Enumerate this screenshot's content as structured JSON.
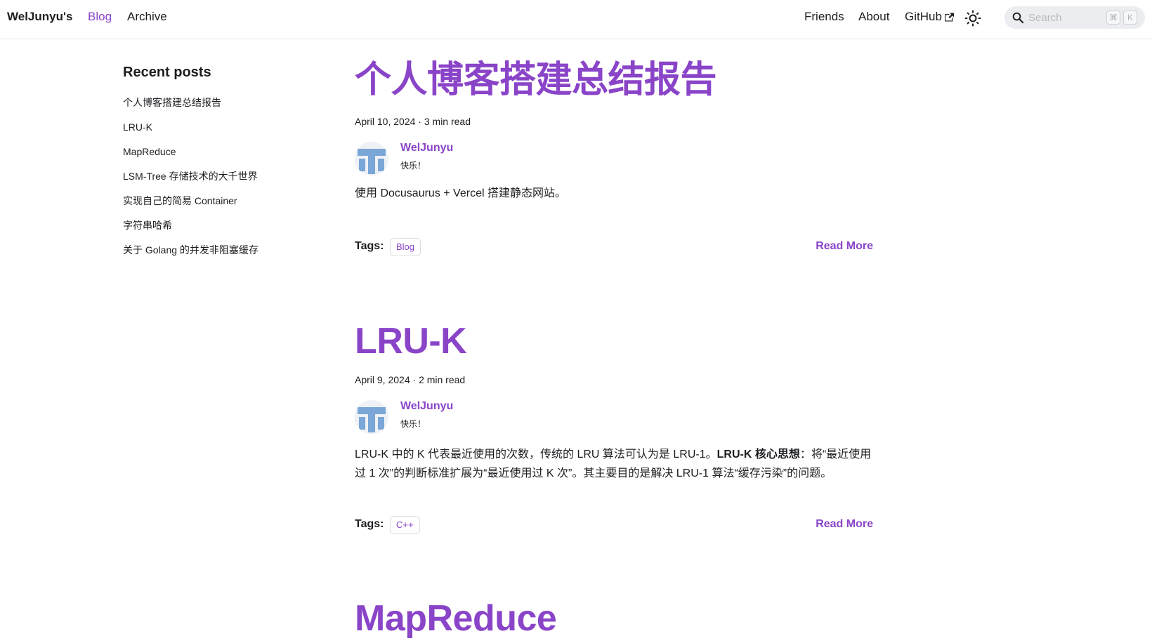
{
  "navbar": {
    "brand": "WelJunyu's",
    "left_items": [
      "Blog",
      "Archive"
    ],
    "right_items": {
      "friends": "Friends",
      "about": "About",
      "github": "GitHub"
    },
    "theme_icon": "sun-icon",
    "search": {
      "placeholder": "Search",
      "kbd_cmd": "⌘",
      "kbd_k": "K"
    }
  },
  "sidebar": {
    "title": "Recent posts",
    "items": [
      "个人博客搭建总结报告",
      "LRU-K",
      "MapReduce",
      "LSM-Tree 存储技术的大千世界",
      "实现自己的简易 Container",
      "字符串哈希",
      "关于 Golang 的并发非阻塞缓存"
    ]
  },
  "posts": [
    {
      "title": "个人博客搭建总结报告",
      "date": "April 10, 2024",
      "sep": " · ",
      "read_time": "3 min read",
      "author": "WelJunyu",
      "author_subtitle": "快乐！",
      "summary": "使用 Docusaurus + Vercel 搭建静态网站。",
      "tags_label": "Tags:",
      "tag": "Blog",
      "read_more": "Read More"
    },
    {
      "title": "LRU-K",
      "date": "April 9, 2024",
      "sep": " · ",
      "read_time": "2 min read",
      "author": "WelJunyu",
      "author_subtitle": "快乐！",
      "summary_part1": "LRU-K 中的 K 代表最近使用的次数，传统的 LRU 算法可认为是 LRU-1。",
      "summary_bold": "LRU-K 核心思想",
      "summary_part2": "：将“最近使用过 1 次”的判断标准扩展为“最近使用过 K 次”。其主要目的是解决 LRU-1 算法“缓存污染”的问题。",
      "tags_label": "Tags:",
      "tag": "C++",
      "read_more": "Read More"
    },
    {
      "title": "MapReduce"
    }
  ],
  "colors": {
    "accent": "#8a44c8",
    "text": "#1c1e21",
    "border": "#dadde1",
    "search_bg": "#ebedf0"
  }
}
